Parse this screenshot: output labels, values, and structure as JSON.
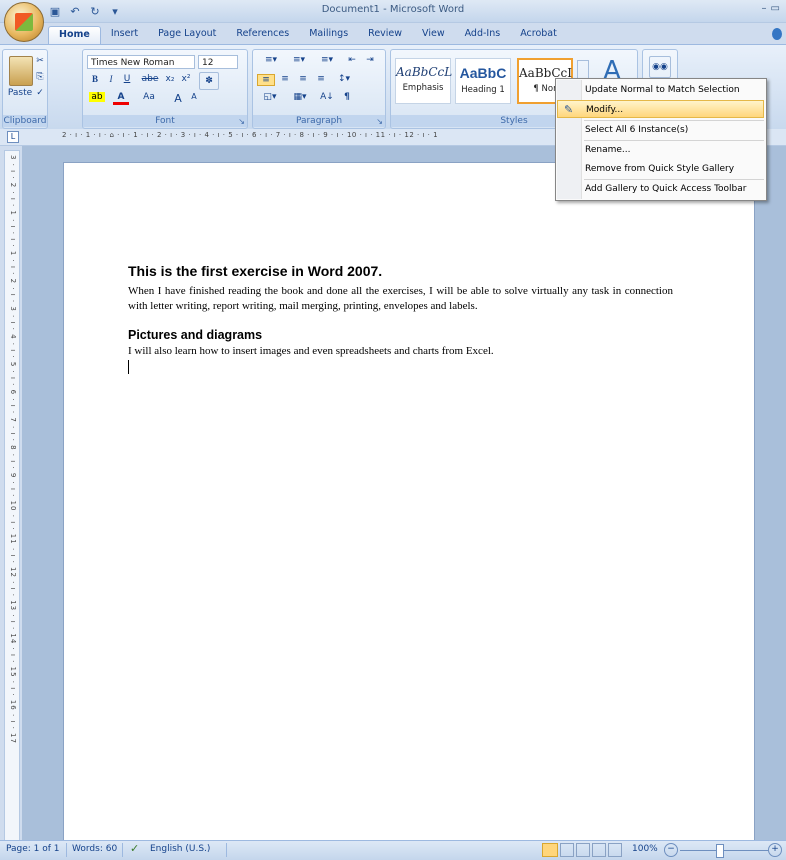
{
  "window": {
    "title": "Document1 - Microsoft Word",
    "controls": [
      "–",
      "▭"
    ]
  },
  "qat": {
    "save_icon": "save-icon",
    "undo_icon": "undo-icon",
    "redo_icon": "redo-icon",
    "customize": "▾"
  },
  "tabs": [
    "Home",
    "Insert",
    "Page Layout",
    "References",
    "Mailings",
    "Review",
    "View",
    "Add-Ins",
    "Acrobat"
  ],
  "ribbon": {
    "clipboard": {
      "label": "Clipboard",
      "paste": "Paste"
    },
    "font": {
      "label": "Font",
      "font_name": "Times New Roman",
      "font_size": "12",
      "bold": "B",
      "italic": "I",
      "underline": "U",
      "strike": "abe",
      "sub": "x₂",
      "sup": "x²",
      "grow": "A",
      "shrink": "A",
      "case": "Aa"
    },
    "paragraph": {
      "label": "Paragraph",
      "sort": "A↓",
      "pilcrow": "¶"
    },
    "styles": {
      "label": "Styles",
      "tiles": [
        {
          "sample": "AaBbCcL",
          "name": "Emphasis"
        },
        {
          "sample": "AaBbC",
          "name": "Heading 1"
        },
        {
          "sample": "AaBbCcI",
          "name": "¶ Nor"
        }
      ],
      "change_styles": "A"
    },
    "editing": {
      "find": "⌗"
    }
  },
  "ruler": {
    "h_text": "2 · ı · 1 · ı · ⌂ · ı · 1 · ı · 2 · ı · 3 · ı · 4 · ı · 5 · ı · 6 · ı · 7 · ı · 8 · ı · 9 · ı · 10 · ı · 11 · ı · 12 · ı · 1",
    "v_text": "3 · ı · 2 · ı · 1 · ı · ı · 1 · ı · 2 · ı · 3 · ı · 4 · ı · 5 · ı · 6 · ı · 7 · ı · 8 · ı · 9 · ı · 10 · ı · 11 · ı · 12 · ı · 13 · ı · 14 · ı · 15 · ı · 16 · ı · 17",
    "corner": "L"
  },
  "document": {
    "heading1": "This is the first exercise in Word 2007.",
    "para1": "When I have finished reading the book and done all the exercises, I will be able to solve virtually any task in connection with letter writing, report writing, mail merging, printing, envelopes and labels.",
    "heading2": "Pictures and diagrams",
    "para2": "I will also learn how to insert images and even spreadsheets and charts from Excel."
  },
  "context_menu": {
    "items": [
      "Update Normal to Match Selection",
      "Modify...",
      "Select All 6 Instance(s)",
      "Rename...",
      "Remove from Quick Style Gallery",
      "Add Gallery to Quick Access Toolbar"
    ],
    "highlighted_index": 1
  },
  "statusbar": {
    "page": "Page: 1 of 1",
    "words": "Words: 60",
    "language": "English (U.S.)",
    "zoom": "100%"
  }
}
